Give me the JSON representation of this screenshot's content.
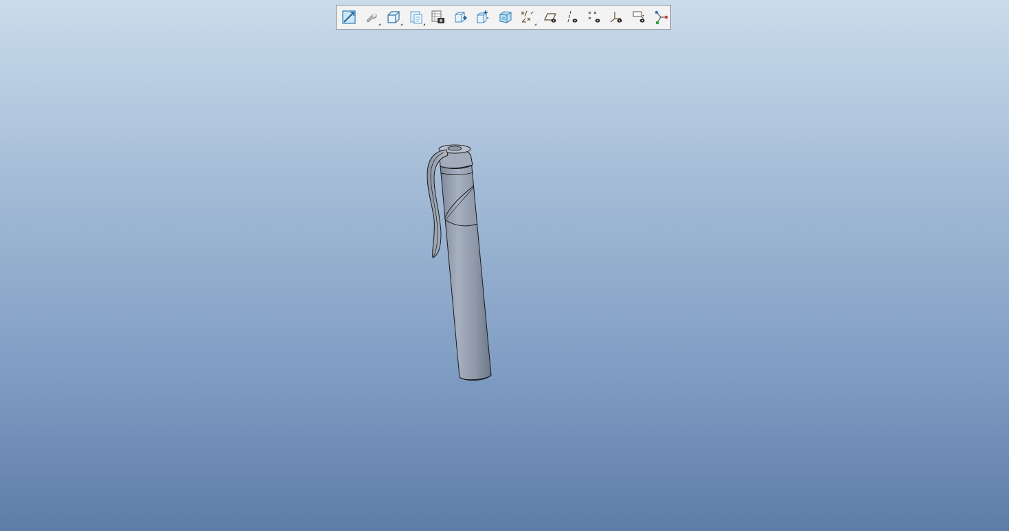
{
  "toolbar": {
    "buttons": [
      {
        "icon": "refit-icon",
        "tooltip": "",
        "has_dropdown": false
      },
      {
        "icon": "display-style-icon",
        "tooltip": "",
        "has_dropdown": true
      },
      {
        "icon": "saved-orientations-icon",
        "tooltip": "",
        "has_dropdown": true
      },
      {
        "icon": "view-manager-icon",
        "tooltip": "",
        "has_dropdown": true
      },
      {
        "icon": "snapshot-icon",
        "tooltip": "",
        "has_dropdown": false
      },
      {
        "icon": "zoom-in-icon",
        "tooltip": "",
        "has_dropdown": false
      },
      {
        "icon": "zoom-out-icon",
        "tooltip": "",
        "has_dropdown": false
      },
      {
        "icon": "perspective-icon",
        "tooltip": "",
        "has_dropdown": false
      },
      {
        "icon": "datum-display-icon",
        "tooltip": "",
        "has_dropdown": true
      },
      {
        "icon": "plane-display-icon",
        "tooltip": "",
        "has_dropdown": false
      },
      {
        "icon": "axis-display-icon",
        "tooltip": "",
        "has_dropdown": false
      },
      {
        "icon": "point-display-icon",
        "tooltip": "",
        "has_dropdown": false
      },
      {
        "icon": "csys-display-icon",
        "tooltip": "",
        "has_dropdown": false
      },
      {
        "icon": "annotation-display-icon",
        "tooltip": "",
        "has_dropdown": false
      },
      {
        "icon": "spin-center-icon",
        "tooltip": "",
        "has_dropdown": false
      }
    ]
  },
  "model": {
    "name": "pen",
    "display_style": "shaded-with-edges"
  },
  "colors": {
    "background_top": "#c9dceb",
    "background_bottom": "#5d7ca8",
    "model_fill": "#8f9aab",
    "model_edge": "#1a1a1a"
  }
}
